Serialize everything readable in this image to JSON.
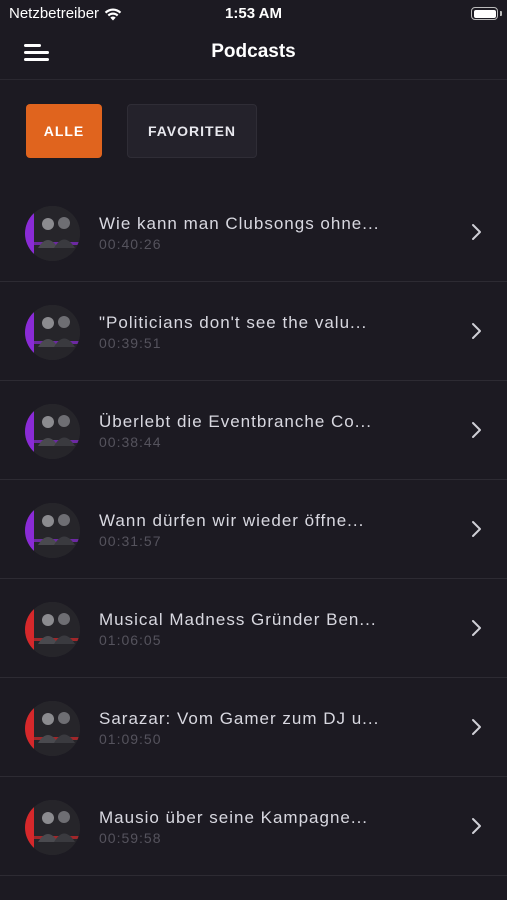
{
  "status_bar": {
    "carrier": "Netzbetreiber",
    "time": "1:53 AM"
  },
  "nav": {
    "title": "Podcasts"
  },
  "filters": {
    "all_label": "ALLE",
    "favorites_label": "FAVORITEN"
  },
  "colors": {
    "accent": "#e0641e",
    "background": "#1c1a22",
    "purple_stripe": "#8a2bd6",
    "red_stripe": "#d6282b"
  },
  "episodes": [
    {
      "title": "Wie kann man Clubsongs ohne...",
      "duration": "00:40:26",
      "stripe": "purple"
    },
    {
      "title": "\"Politicians don't see the valu...",
      "duration": "00:39:51",
      "stripe": "purple"
    },
    {
      "title": "Überlebt die Eventbranche Co...",
      "duration": "00:38:44",
      "stripe": "purple"
    },
    {
      "title": "Wann dürfen wir wieder öffne...",
      "duration": "00:31:57",
      "stripe": "purple"
    },
    {
      "title": "Musical Madness Gründer Ben...",
      "duration": "01:06:05",
      "stripe": "red"
    },
    {
      "title": "Sarazar: Vom Gamer zum DJ u...",
      "duration": "01:09:50",
      "stripe": "red"
    },
    {
      "title": "Mausio über seine Kampagne...",
      "duration": "00:59:58",
      "stripe": "red"
    }
  ]
}
